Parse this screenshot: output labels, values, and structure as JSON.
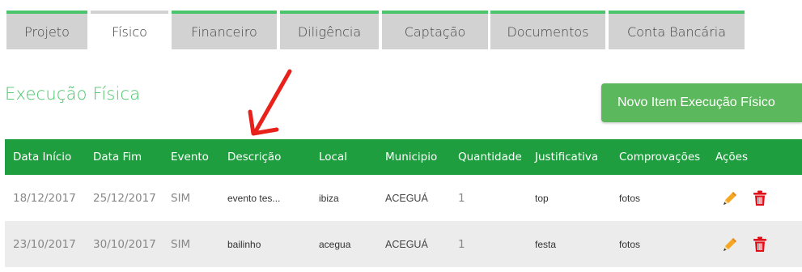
{
  "tabs": [
    {
      "label": "Projeto",
      "active": false
    },
    {
      "label": "Físico",
      "active": true
    },
    {
      "label": "Financeiro",
      "active": false
    },
    {
      "label": "Diligência",
      "active": false
    },
    {
      "label": "Captação",
      "active": false
    },
    {
      "label": "Documentos",
      "active": false
    },
    {
      "label": "Conta Bancária",
      "active": false
    }
  ],
  "section": {
    "title": "Execução Física",
    "new_button_label": "Novo Item Execução Físico"
  },
  "table": {
    "columns": [
      "Data Início",
      "Data Fim",
      "Evento",
      "Descrição",
      "Local",
      "Municipio",
      "Quantidade",
      "Justificativa",
      "Comprovações",
      "Ações"
    ],
    "rows": [
      {
        "data_inicio": "18/12/2017",
        "data_fim": "25/12/2017",
        "evento": "SIM",
        "descricao": "evento tes...",
        "local": "ibiza",
        "municipio": "ACEGUÁ",
        "quantidade": "1",
        "justificativa": "top",
        "comprovacoes": "fotos"
      },
      {
        "data_inicio": "23/10/2017",
        "data_fim": "30/10/2017",
        "evento": "SIM",
        "descricao": "bailinho",
        "local": "acegua",
        "municipio": "ACEGUÁ",
        "quantidade": "1",
        "justificativa": "festa",
        "comprovacoes": "fotos"
      }
    ]
  },
  "icons": {
    "edit": "pencil-icon",
    "delete": "trash-icon",
    "annotation": "red-arrow"
  },
  "colors": {
    "accent": "#4bc56b",
    "header_bg": "#1e9e3e",
    "button_bg": "#5cb85c",
    "delete": "#e0101a",
    "arrow": "#e8221b"
  }
}
